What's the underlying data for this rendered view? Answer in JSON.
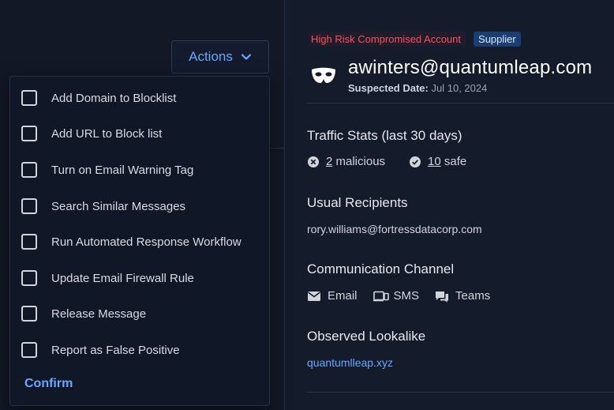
{
  "actions": {
    "label": "Actions",
    "chevron_icon": "chevron-down-icon",
    "menu_items": [
      {
        "label": "Add Domain to Blocklist",
        "checked": false
      },
      {
        "label": "Add URL to Block list",
        "checked": false
      },
      {
        "label": "Turn on Email Warning Tag",
        "checked": false
      },
      {
        "label": "Search Similar Messages",
        "checked": false
      },
      {
        "label": "Run Automated Response Workflow",
        "checked": false
      },
      {
        "label": "Update Email Firewall Rule",
        "checked": false
      },
      {
        "label": "Release Message",
        "checked": false
      },
      {
        "label": "Report as False Positive",
        "checked": false
      }
    ],
    "confirm_label": "Confirm"
  },
  "details": {
    "risk_badge": "High Risk Compromised Account",
    "type_badge": "Supplier",
    "account_icon": "mask-icon",
    "email": "awinters@quantumleap.com",
    "suspected_label": "Suspected Date:",
    "suspected_date": "Jul 10, 2024",
    "traffic": {
      "title": "Traffic Stats (last 30 days)",
      "malicious_count": "2",
      "malicious_label": "malicious",
      "safe_count": "10",
      "safe_label": "safe"
    },
    "recipients": {
      "title": "Usual Recipients",
      "value": "rory.williams@fortressdatacorp.com"
    },
    "communication": {
      "title": "Communication Channel",
      "channels": [
        {
          "label": "Email",
          "icon": "email-icon"
        },
        {
          "label": "SMS",
          "icon": "sms-icon"
        },
        {
          "label": "Teams",
          "icon": "chat-icon"
        }
      ]
    },
    "lookalike": {
      "title": "Observed Lookalike",
      "value": "quantumlleap.xyz"
    }
  },
  "colors": {
    "accent": "#6aa7ff",
    "risk": "#ff4d57",
    "supplier_bg": "#1b3e72"
  }
}
